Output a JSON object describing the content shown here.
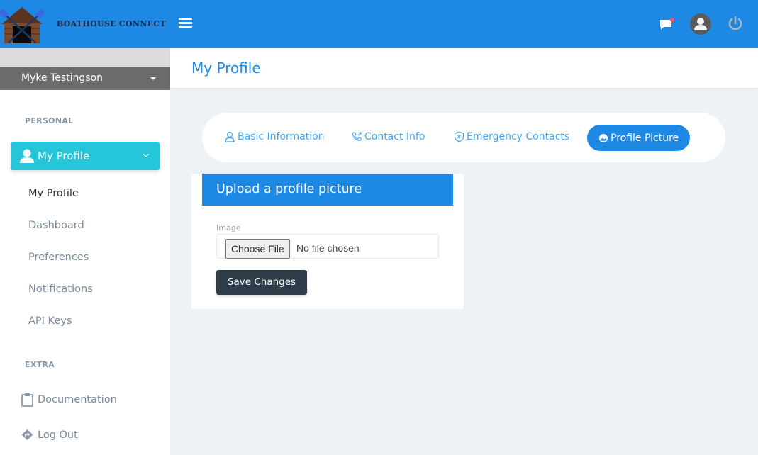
{
  "app": {
    "brand": "BOATHOUSE CONNECT",
    "colors": {
      "primary": "#1e88e5",
      "accent": "#26c6da",
      "dark": "#2f3d4a",
      "notification_dot": "#ff4d6d"
    }
  },
  "topbar": {
    "icons": [
      "menu-icon",
      "message-icon",
      "avatar-icon",
      "power-icon"
    ],
    "has_notification": true
  },
  "sidebar": {
    "user_name": "Myke Testingson",
    "sections": [
      {
        "label": "PERSONAL"
      },
      {
        "label": "EXTRA"
      }
    ],
    "active_group": {
      "label": "My Profile",
      "icon": "user-icon"
    },
    "sub_items": [
      {
        "label": "My Profile",
        "current": true
      },
      {
        "label": "Dashboard"
      },
      {
        "label": "Preferences"
      },
      {
        "label": "Notifications"
      },
      {
        "label": "API Keys"
      }
    ],
    "extra_items": [
      {
        "label": "Documentation",
        "icon": "clipboard-icon"
      },
      {
        "label": "Log Out",
        "icon": "directions-icon"
      }
    ]
  },
  "main": {
    "page_title": "My Profile",
    "tabs": [
      {
        "label": "Basic Information",
        "icon": "user-icon"
      },
      {
        "label": "Contact Info",
        "icon": "phone-icon"
      },
      {
        "label": "Emergency Contacts",
        "icon": "shield-icon"
      },
      {
        "label": "Profile Picture",
        "icon": "picture-icon",
        "active": true
      }
    ],
    "upload": {
      "title": "Upload a profile picture",
      "field_label": "Image",
      "choose_label": "Choose File",
      "file_status": "No file chosen",
      "save_label": "Save Changes"
    }
  }
}
